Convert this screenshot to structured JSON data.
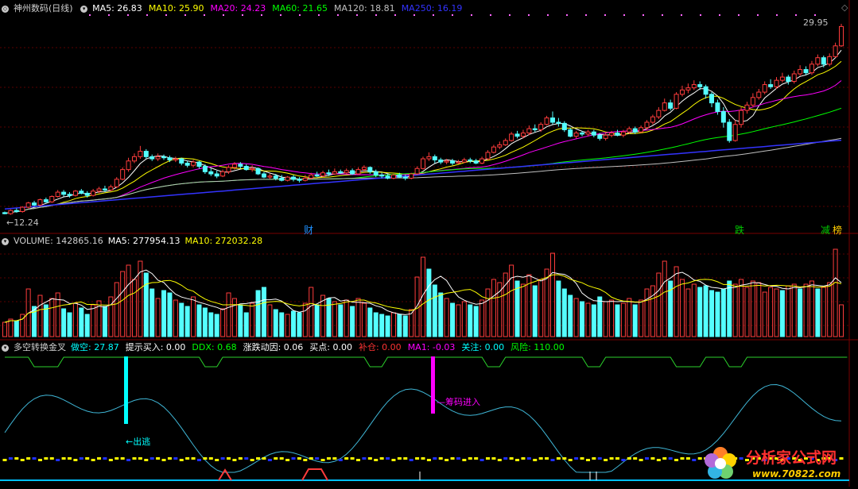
{
  "price_panel": {
    "title": "神州数码(日线)",
    "ma_labels": [
      {
        "text": "MA5: 26.83",
        "color": "#ffffff"
      },
      {
        "text": "MA10: 25.90",
        "color": "#ffff00"
      },
      {
        "text": "MA20: 24.23",
        "color": "#ff00ff"
      },
      {
        "text": "MA60: 21.65",
        "color": "#00ff00"
      },
      {
        "text": "MA120: 18.81",
        "color": "#c0c0c0"
      },
      {
        "text": "MA250: 16.19",
        "color": "#3333ff"
      }
    ],
    "high_label": "29.95",
    "low_label": "←12.24",
    "events": [
      {
        "text": "财",
        "color": "#1e90ff"
      },
      {
        "text": "跌",
        "color": "#00cc00"
      },
      {
        "text": "减",
        "color": "#00cc00"
      },
      {
        "text": "榜",
        "color": "#ffcc00"
      }
    ]
  },
  "volume_panel": {
    "title": "VOLUME: 142865.16",
    "ma5": "MA5: 277954.13",
    "ma10": "MA10: 272032.28"
  },
  "indicator_panel": {
    "title": "多空转换金叉",
    "labels": [
      {
        "text": "做空: 27.87",
        "color": "#00ffff"
      },
      {
        "text": "提示买入: 0.00",
        "color": "#ffffff"
      },
      {
        "text": "DDX: 0.68",
        "color": "#00ff00"
      },
      {
        "text": "涨跌动因: 0.06",
        "color": "#ffffff"
      },
      {
        "text": "买点: 0.00",
        "color": "#ffffff"
      },
      {
        "text": "补仓: 0.00",
        "color": "#ff3333"
      },
      {
        "text": "MA1: -0.03",
        "color": "#ff00ff"
      },
      {
        "text": "关注: 0.00",
        "color": "#00ffff"
      },
      {
        "text": "风险: 110.00",
        "color": "#00ff00"
      }
    ],
    "annotations": {
      "escape": "←出逃",
      "chips": "筹码进入"
    }
  },
  "watermark": {
    "text": "分析家公式网",
    "url": "www.70822.com"
  },
  "chart_data": {
    "type": "candlestick",
    "price_axis": {
      "min": 12.24,
      "max": 29.95
    },
    "candles": [
      [
        12.4,
        12.3,
        12.5,
        12.24
      ],
      [
        12.3,
        12.6,
        12.7,
        12.2
      ],
      [
        12.6,
        12.5,
        12.8,
        12.4
      ],
      [
        12.5,
        12.9,
        13.0,
        12.4
      ],
      [
        12.9,
        13.3,
        13.4,
        12.8
      ],
      [
        13.3,
        13.1,
        13.5,
        13.0
      ],
      [
        13.1,
        13.6,
        13.7,
        13.0
      ],
      [
        13.6,
        13.4,
        13.8,
        13.3
      ],
      [
        13.4,
        13.9,
        14.0,
        13.3
      ],
      [
        13.9,
        14.3,
        14.5,
        13.8
      ],
      [
        14.3,
        14.1,
        14.5,
        13.9
      ],
      [
        14.1,
        14.0,
        14.3,
        13.8
      ],
      [
        14.0,
        14.4,
        14.5,
        13.9
      ],
      [
        14.4,
        14.2,
        14.6,
        14.1
      ],
      [
        14.2,
        14.0,
        14.4,
        13.8
      ],
      [
        14.0,
        14.4,
        14.6,
        13.9
      ],
      [
        14.4,
        14.6,
        14.8,
        14.2
      ],
      [
        14.6,
        14.5,
        14.9,
        14.3
      ],
      [
        14.5,
        14.8,
        15.0,
        14.4
      ],
      [
        14.8,
        15.5,
        15.7,
        14.7
      ],
      [
        15.5,
        16.4,
        16.6,
        15.4
      ],
      [
        16.4,
        17.2,
        17.5,
        16.2
      ],
      [
        17.2,
        17.6,
        17.9,
        17.0
      ],
      [
        17.6,
        18.1,
        18.6,
        17.4
      ],
      [
        18.1,
        17.6,
        18.3,
        17.4
      ],
      [
        17.6,
        17.4,
        17.8,
        17.2
      ],
      [
        17.4,
        17.6,
        17.9,
        17.2
      ],
      [
        17.6,
        17.5,
        17.8,
        17.3
      ],
      [
        17.5,
        17.3,
        17.7,
        17.1
      ],
      [
        17.3,
        17.4,
        17.6,
        17.1
      ],
      [
        17.4,
        17.0,
        17.5,
        16.8
      ],
      [
        17.0,
        16.8,
        17.2,
        16.6
      ],
      [
        16.8,
        17.1,
        17.3,
        16.6
      ],
      [
        17.1,
        16.7,
        17.2,
        16.5
      ],
      [
        16.7,
        16.2,
        16.9,
        16.0
      ],
      [
        16.2,
        16.0,
        16.5,
        15.8
      ],
      [
        16.0,
        15.8,
        16.3,
        15.6
      ],
      [
        15.8,
        16.2,
        16.4,
        15.7
      ],
      [
        16.2,
        16.6,
        16.8,
        16.0
      ],
      [
        16.6,
        16.9,
        17.1,
        16.4
      ],
      [
        16.9,
        16.7,
        17.1,
        16.5
      ],
      [
        16.7,
        16.4,
        16.9,
        16.3
      ],
      [
        16.4,
        16.5,
        16.8,
        16.2
      ],
      [
        16.5,
        16.0,
        16.6,
        15.9
      ],
      [
        16.0,
        15.7,
        16.2,
        15.6
      ],
      [
        15.7,
        15.8,
        16.0,
        15.5
      ],
      [
        15.8,
        15.6,
        16.0,
        15.4
      ],
      [
        15.6,
        15.4,
        15.9,
        15.3
      ],
      [
        15.4,
        15.7,
        15.8,
        15.3
      ],
      [
        15.7,
        15.5,
        15.9,
        15.3
      ],
      [
        15.5,
        15.4,
        15.7,
        15.2
      ],
      [
        15.4,
        15.6,
        15.9,
        15.3
      ],
      [
        15.6,
        15.9,
        16.1,
        15.5
      ],
      [
        15.9,
        15.8,
        16.2,
        15.7
      ],
      [
        15.8,
        16.1,
        16.3,
        15.7
      ],
      [
        16.1,
        16.0,
        16.4,
        15.8
      ],
      [
        16.0,
        16.2,
        16.5,
        15.9
      ],
      [
        16.2,
        16.1,
        16.4,
        16.0
      ],
      [
        16.1,
        16.3,
        16.5,
        16.0
      ],
      [
        16.3,
        16.0,
        16.5,
        15.9
      ],
      [
        16.0,
        16.4,
        16.6,
        15.9
      ],
      [
        16.4,
        16.6,
        16.8,
        16.2
      ],
      [
        16.6,
        16.2,
        16.7,
        16.0
      ],
      [
        16.2,
        15.9,
        16.4,
        15.7
      ],
      [
        15.9,
        15.8,
        16.1,
        15.6
      ],
      [
        15.8,
        15.6,
        16.0,
        15.5
      ],
      [
        15.6,
        15.9,
        16.0,
        15.5
      ],
      [
        15.9,
        15.7,
        16.1,
        15.6
      ],
      [
        15.7,
        15.6,
        15.9,
        15.4
      ],
      [
        15.6,
        16.0,
        16.1,
        15.5
      ],
      [
        16.0,
        16.5,
        16.7,
        15.9
      ],
      [
        16.5,
        17.4,
        17.6,
        16.4
      ],
      [
        17.4,
        17.6,
        18.0,
        17.2
      ],
      [
        17.6,
        17.3,
        17.8,
        17.0
      ],
      [
        17.3,
        17.1,
        17.5,
        16.9
      ],
      [
        17.1,
        17.2,
        17.4,
        16.9
      ],
      [
        17.2,
        17.0,
        17.4,
        16.8
      ],
      [
        17.0,
        17.1,
        17.3,
        16.9
      ],
      [
        17.1,
        17.3,
        17.5,
        17.0
      ],
      [
        17.3,
        17.2,
        17.5,
        17.0
      ],
      [
        17.2,
        17.0,
        17.4,
        16.9
      ],
      [
        17.0,
        17.4,
        17.6,
        16.9
      ],
      [
        17.4,
        18.0,
        18.2,
        17.3
      ],
      [
        18.0,
        18.5,
        18.7,
        17.9
      ],
      [
        18.5,
        18.7,
        19.0,
        18.3
      ],
      [
        18.7,
        19.1,
        19.3,
        18.6
      ],
      [
        19.1,
        19.7,
        19.9,
        19.0
      ],
      [
        19.7,
        19.5,
        20.0,
        19.3
      ],
      [
        19.5,
        19.8,
        20.1,
        19.3
      ],
      [
        19.8,
        20.2,
        20.5,
        19.6
      ],
      [
        20.2,
        20.1,
        20.6,
        19.9
      ],
      [
        20.1,
        20.6,
        20.8,
        19.9
      ],
      [
        20.6,
        21.2,
        21.4,
        20.5
      ],
      [
        21.2,
        20.8,
        21.8,
        20.6
      ],
      [
        20.8,
        20.7,
        21.2,
        20.4
      ],
      [
        20.7,
        20.1,
        20.9,
        19.9
      ],
      [
        20.1,
        19.5,
        20.3,
        19.4
      ],
      [
        19.5,
        19.8,
        20.0,
        19.3
      ],
      [
        19.8,
        19.7,
        20.0,
        19.5
      ],
      [
        19.7,
        19.9,
        20.1,
        19.5
      ],
      [
        19.9,
        19.6,
        20.1,
        19.4
      ],
      [
        19.6,
        19.3,
        19.8,
        19.1
      ],
      [
        19.3,
        19.6,
        19.8,
        19.1
      ],
      [
        19.6,
        19.8,
        20.0,
        19.4
      ],
      [
        19.8,
        19.6,
        20.1,
        19.5
      ],
      [
        19.6,
        19.9,
        20.1,
        19.4
      ],
      [
        19.9,
        20.2,
        20.4,
        19.7
      ],
      [
        20.2,
        19.9,
        20.4,
        19.7
      ],
      [
        19.9,
        20.3,
        20.5,
        19.8
      ],
      [
        20.3,
        20.8,
        21.0,
        20.1
      ],
      [
        20.8,
        21.3,
        21.5,
        20.6
      ],
      [
        21.3,
        21.9,
        22.2,
        21.1
      ],
      [
        21.9,
        22.6,
        23.0,
        21.8
      ],
      [
        22.6,
        22.1,
        22.9,
        21.9
      ],
      [
        22.1,
        23.4,
        23.6,
        22.0
      ],
      [
        23.4,
        23.8,
        24.2,
        23.2
      ],
      [
        23.8,
        24.0,
        24.4,
        23.5
      ],
      [
        24.0,
        24.3,
        24.7,
        23.8
      ],
      [
        24.3,
        24.1,
        24.6,
        23.8
      ],
      [
        24.1,
        23.4,
        24.3,
        23.0
      ],
      [
        23.4,
        22.6,
        23.6,
        22.2
      ],
      [
        22.6,
        21.8,
        22.9,
        21.5
      ],
      [
        21.8,
        20.8,
        22.2,
        20.3
      ],
      [
        20.8,
        19.1,
        21.1,
        18.9
      ],
      [
        19.1,
        20.6,
        21.0,
        19.0
      ],
      [
        20.6,
        21.9,
        22.2,
        20.3
      ],
      [
        21.9,
        22.4,
        22.7,
        21.6
      ],
      [
        22.4,
        23.1,
        23.5,
        22.2
      ],
      [
        23.1,
        23.6,
        23.9,
        22.9
      ],
      [
        23.6,
        24.3,
        24.6,
        23.4
      ],
      [
        24.3,
        24.1,
        24.8,
        23.9
      ],
      [
        24.1,
        24.7,
        25.0,
        23.9
      ],
      [
        24.7,
        25.0,
        25.4,
        24.5
      ],
      [
        25.0,
        24.6,
        25.2,
        24.3
      ],
      [
        24.6,
        25.3,
        25.6,
        24.4
      ],
      [
        25.3,
        25.7,
        26.1,
        25.1
      ],
      [
        25.7,
        25.4,
        26.0,
        25.2
      ],
      [
        25.4,
        26.2,
        26.5,
        25.2
      ],
      [
        26.2,
        26.8,
        27.1,
        26.0
      ],
      [
        26.8,
        26.2,
        27.0,
        25.9
      ],
      [
        26.2,
        26.9,
        27.2,
        26.0
      ],
      [
        26.9,
        27.9,
        28.2,
        26.8
      ],
      [
        27.9,
        29.7,
        29.95,
        27.8
      ]
    ],
    "volume": [
      {
        "v": 18,
        "u": 1
      },
      {
        "v": 22,
        "u": 1
      },
      {
        "v": 20,
        "u": 0
      },
      {
        "v": 28,
        "u": 1
      },
      {
        "v": 60,
        "u": 1
      },
      {
        "v": 38,
        "u": 0
      },
      {
        "v": 52,
        "u": 1
      },
      {
        "v": 40,
        "u": 0
      },
      {
        "v": 48,
        "u": 1
      },
      {
        "v": 55,
        "u": 1
      },
      {
        "v": 35,
        "u": 0
      },
      {
        "v": 30,
        "u": 0
      },
      {
        "v": 42,
        "u": 1
      },
      {
        "v": 36,
        "u": 0
      },
      {
        "v": 28,
        "u": 0
      },
      {
        "v": 40,
        "u": 1
      },
      {
        "v": 45,
        "u": 1
      },
      {
        "v": 38,
        "u": 0
      },
      {
        "v": 50,
        "u": 1
      },
      {
        "v": 68,
        "u": 1
      },
      {
        "v": 82,
        "u": 1
      },
      {
        "v": 90,
        "u": 1
      },
      {
        "v": 72,
        "u": 1
      },
      {
        "v": 95,
        "u": 1
      },
      {
        "v": 80,
        "u": 0
      },
      {
        "v": 60,
        "u": 0
      },
      {
        "v": 48,
        "u": 1
      },
      {
        "v": 58,
        "u": 0
      },
      {
        "v": 55,
        "u": 0
      },
      {
        "v": 46,
        "u": 1
      },
      {
        "v": 42,
        "u": 0
      },
      {
        "v": 38,
        "u": 0
      },
      {
        "v": 50,
        "u": 1
      },
      {
        "v": 40,
        "u": 0
      },
      {
        "v": 36,
        "u": 0
      },
      {
        "v": 30,
        "u": 0
      },
      {
        "v": 28,
        "u": 0
      },
      {
        "v": 35,
        "u": 1
      },
      {
        "v": 55,
        "u": 1
      },
      {
        "v": 48,
        "u": 1
      },
      {
        "v": 40,
        "u": 0
      },
      {
        "v": 30,
        "u": 0
      },
      {
        "v": 42,
        "u": 1
      },
      {
        "v": 58,
        "u": 0
      },
      {
        "v": 62,
        "u": 0
      },
      {
        "v": 40,
        "u": 1
      },
      {
        "v": 34,
        "u": 0
      },
      {
        "v": 30,
        "u": 0
      },
      {
        "v": 28,
        "u": 1
      },
      {
        "v": 32,
        "u": 0
      },
      {
        "v": 30,
        "u": 0
      },
      {
        "v": 42,
        "u": 1
      },
      {
        "v": 62,
        "u": 1
      },
      {
        "v": 40,
        "u": 0
      },
      {
        "v": 52,
        "u": 1
      },
      {
        "v": 48,
        "u": 0
      },
      {
        "v": 44,
        "u": 1
      },
      {
        "v": 40,
        "u": 0
      },
      {
        "v": 46,
        "u": 1
      },
      {
        "v": 38,
        "u": 0
      },
      {
        "v": 48,
        "u": 1
      },
      {
        "v": 42,
        "u": 1
      },
      {
        "v": 36,
        "u": 0
      },
      {
        "v": 30,
        "u": 0
      },
      {
        "v": 28,
        "u": 0
      },
      {
        "v": 26,
        "u": 0
      },
      {
        "v": 30,
        "u": 1
      },
      {
        "v": 28,
        "u": 0
      },
      {
        "v": 26,
        "u": 0
      },
      {
        "v": 34,
        "u": 1
      },
      {
        "v": 75,
        "u": 1
      },
      {
        "v": 100,
        "u": 1
      },
      {
        "v": 85,
        "u": 0
      },
      {
        "v": 65,
        "u": 0
      },
      {
        "v": 55,
        "u": 0
      },
      {
        "v": 48,
        "u": 1
      },
      {
        "v": 42,
        "u": 0
      },
      {
        "v": 40,
        "u": 1
      },
      {
        "v": 44,
        "u": 1
      },
      {
        "v": 40,
        "u": 0
      },
      {
        "v": 38,
        "u": 0
      },
      {
        "v": 46,
        "u": 1
      },
      {
        "v": 60,
        "u": 1
      },
      {
        "v": 72,
        "u": 1
      },
      {
        "v": 68,
        "u": 1
      },
      {
        "v": 80,
        "u": 1
      },
      {
        "v": 90,
        "u": 1
      },
      {
        "v": 70,
        "u": 0
      },
      {
        "v": 66,
        "u": 1
      },
      {
        "v": 78,
        "u": 1
      },
      {
        "v": 64,
        "u": 0
      },
      {
        "v": 72,
        "u": 1
      },
      {
        "v": 85,
        "u": 1
      },
      {
        "v": 105,
        "u": 1
      },
      {
        "v": 70,
        "u": 0
      },
      {
        "v": 60,
        "u": 0
      },
      {
        "v": 52,
        "u": 0
      },
      {
        "v": 48,
        "u": 1
      },
      {
        "v": 44,
        "u": 0
      },
      {
        "v": 42,
        "u": 1
      },
      {
        "v": 40,
        "u": 0
      },
      {
        "v": 50,
        "u": 0
      },
      {
        "v": 44,
        "u": 1
      },
      {
        "v": 46,
        "u": 1
      },
      {
        "v": 40,
        "u": 0
      },
      {
        "v": 42,
        "u": 1
      },
      {
        "v": 48,
        "u": 1
      },
      {
        "v": 40,
        "u": 0
      },
      {
        "v": 46,
        "u": 1
      },
      {
        "v": 60,
        "u": 1
      },
      {
        "v": 64,
        "u": 1
      },
      {
        "v": 80,
        "u": 1
      },
      {
        "v": 95,
        "u": 1
      },
      {
        "v": 70,
        "u": 0
      },
      {
        "v": 88,
        "u": 1
      },
      {
        "v": 72,
        "u": 1
      },
      {
        "v": 60,
        "u": 1
      },
      {
        "v": 66,
        "u": 1
      },
      {
        "v": 62,
        "u": 0
      },
      {
        "v": 64,
        "u": 0
      },
      {
        "v": 58,
        "u": 0
      },
      {
        "v": 56,
        "u": 0
      },
      {
        "v": 60,
        "u": 0
      },
      {
        "v": 70,
        "u": 0
      },
      {
        "v": 66,
        "u": 1
      },
      {
        "v": 72,
        "u": 1
      },
      {
        "v": 62,
        "u": 1
      },
      {
        "v": 70,
        "u": 1
      },
      {
        "v": 68,
        "u": 1
      },
      {
        "v": 56,
        "u": 1
      },
      {
        "v": 62,
        "u": 1
      },
      {
        "v": 60,
        "u": 1
      },
      {
        "v": 58,
        "u": 0
      },
      {
        "v": 64,
        "u": 1
      },
      {
        "v": 66,
        "u": 1
      },
      {
        "v": 60,
        "u": 0
      },
      {
        "v": 66,
        "u": 1
      },
      {
        "v": 70,
        "u": 1
      },
      {
        "v": 60,
        "u": 0
      },
      {
        "v": 62,
        "u": 1
      },
      {
        "v": 68,
        "u": 1
      },
      {
        "v": 110,
        "u": 1
      },
      {
        "v": 40,
        "u": 1
      }
    ]
  }
}
